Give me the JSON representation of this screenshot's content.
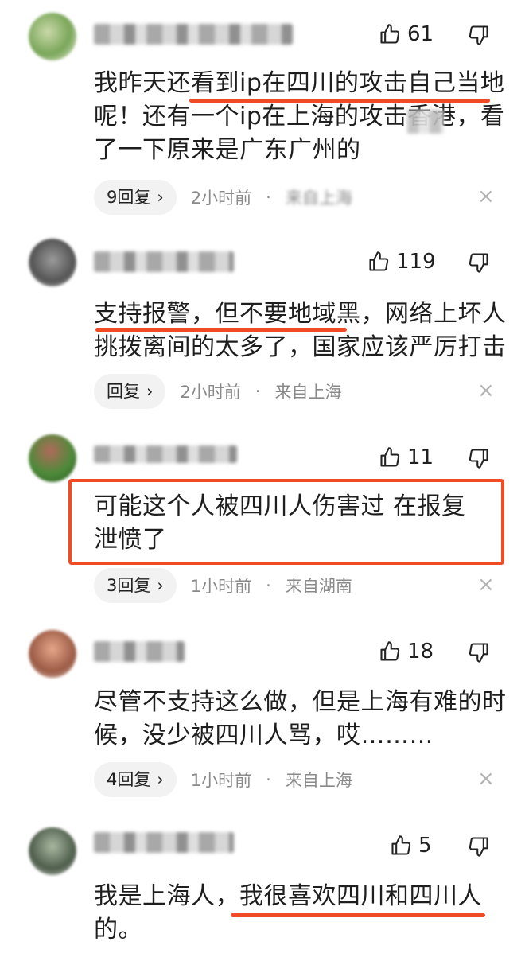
{
  "comments": [
    {
      "likes": "61",
      "text": "我昨天还看到ip在四川的攻击自己当地呢！还有一个ip在上海的攻击香港，看了一下原来是广东广州的",
      "reply_label": "9回复",
      "time": "2小时前",
      "location": "来自上海"
    },
    {
      "likes": "119",
      "text": "支持报警，但不要地域黑，网络上坏人挑拨离间的太多了，国家应该严厉打击",
      "reply_label": "回复",
      "time": "2小时前",
      "location": "来自上海"
    },
    {
      "likes": "11",
      "text": "可能这个人被四川人伤害过 在报复泄愤了",
      "reply_label": "3回复",
      "time": "1小时前",
      "location": "来自湖南"
    },
    {
      "likes": "18",
      "text": "尽管不支持这么做，但是上海有难的时候，没少被四川人骂，哎………",
      "reply_label": "4回复",
      "time": "1小时前",
      "location": "来自上海"
    },
    {
      "likes": "5",
      "text": "我是上海人，我很喜欢四川和四川人的。"
    }
  ],
  "meta_separator": "·",
  "chevron": "›",
  "close_glyph": "×",
  "icons": {
    "like": "thumbs-up-icon",
    "dislike": "thumbs-down-icon",
    "close": "close-icon"
  },
  "colors": {
    "highlight": "#f04b25",
    "meta_text": "#8a8a8a",
    "pill_bg": "#f2f2f2"
  }
}
